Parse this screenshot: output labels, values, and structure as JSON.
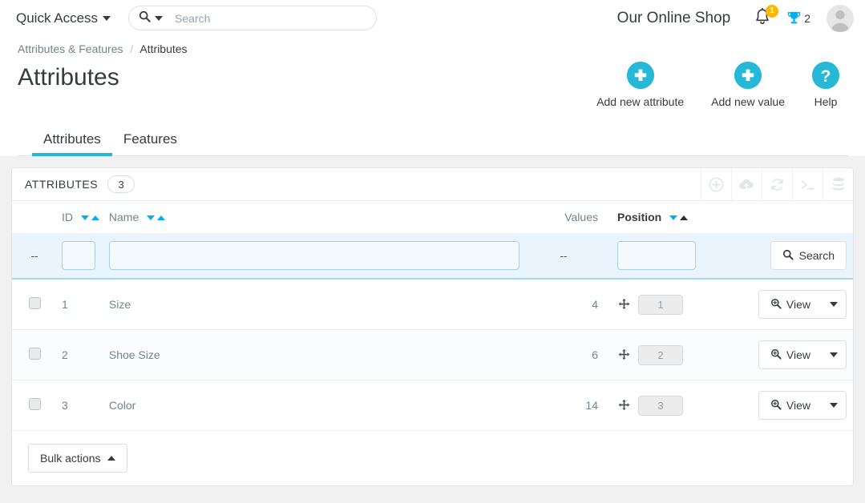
{
  "header": {
    "quick_access_label": "Quick Access",
    "search_placeholder": "Search",
    "search_value": "",
    "shop_name": "Our Online Shop",
    "notifications_count": "1",
    "trophy_count": "2"
  },
  "breadcrumb": {
    "parent": "Attributes & Features",
    "separator": "/",
    "current": "Attributes"
  },
  "page": {
    "title": "Attributes"
  },
  "toolbar": {
    "buttons": [
      {
        "label": "Add new attribute",
        "icon": "plus-circle-icon"
      },
      {
        "label": "Add new value",
        "icon": "plus-circle-icon"
      },
      {
        "label": "Help",
        "icon": "question-circle-icon"
      }
    ]
  },
  "tabs": [
    {
      "label": "Attributes",
      "active": true
    },
    {
      "label": "Features",
      "active": false
    }
  ],
  "panel": {
    "title": "ATTRIBUTES",
    "count": "3",
    "tools": [
      {
        "name": "add-icon"
      },
      {
        "name": "cloud-upload-icon"
      },
      {
        "name": "refresh-icon"
      },
      {
        "name": "console-icon"
      },
      {
        "name": "database-icon"
      }
    ]
  },
  "table": {
    "columns": {
      "checkbox": "",
      "id": "ID",
      "name": "Name",
      "values": "Values",
      "position": "Position",
      "actions": ""
    },
    "sort": {
      "active_column": "Position",
      "direction": "asc"
    },
    "filters": {
      "checkbox_placeholder": "--",
      "id_value": "",
      "name_value": "",
      "values_placeholder": "--",
      "position_value": "",
      "search_label": "Search"
    },
    "rows": [
      {
        "id": "1",
        "name": "Size",
        "values": "4",
        "position": "1",
        "action_label": "View"
      },
      {
        "id": "2",
        "name": "Shoe Size",
        "values": "6",
        "position": "2",
        "action_label": "View"
      },
      {
        "id": "3",
        "name": "Color",
        "values": "14",
        "position": "3",
        "action_label": "View"
      }
    ]
  },
  "footer": {
    "bulk_actions_label": "Bulk actions"
  },
  "colors": {
    "accent": "#25b9d7",
    "sort_arrow": "#00aff0",
    "badge": "#fcb800",
    "filter_row_bg": "#eaf4fc",
    "page_bg": "#f1f1f1"
  }
}
